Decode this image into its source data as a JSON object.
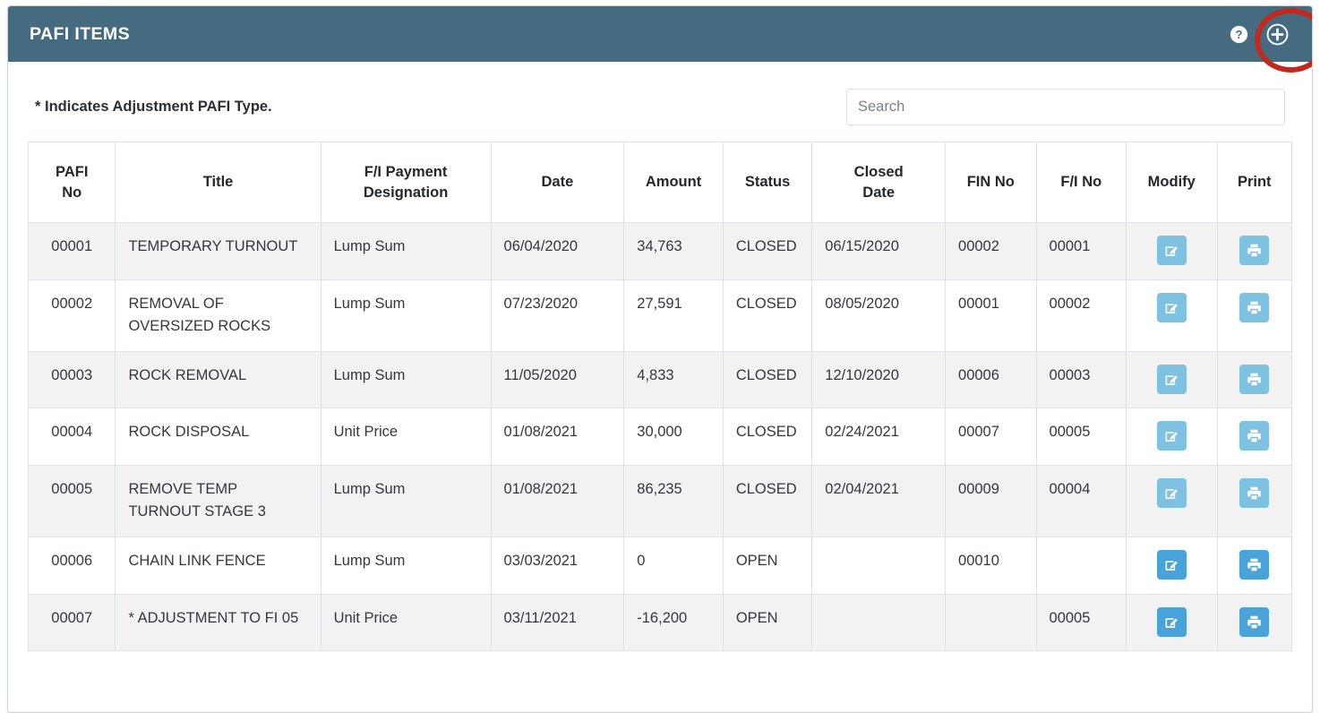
{
  "header": {
    "title": "PAFI ITEMS",
    "help_icon": "help-circle-icon",
    "add_icon": "plus-circle-icon",
    "annotation_color": "#c0291c",
    "background_color": "#456b80"
  },
  "toolbar": {
    "note": "* Indicates Adjustment PAFI Type.",
    "search_placeholder": "Search",
    "search_value": ""
  },
  "table": {
    "columns": [
      "PAFI\nNo",
      "Title",
      "F/I Payment\nDesignation",
      "Date",
      "Amount",
      "Status",
      "Closed\nDate",
      "FIN No",
      "F/I No",
      "Modify",
      "Print"
    ],
    "column_lines": [
      [
        "PAFI",
        "No"
      ],
      [
        "Title"
      ],
      [
        "F/I Payment",
        "Designation"
      ],
      [
        "Date"
      ],
      [
        "Amount"
      ],
      [
        "Status"
      ],
      [
        "Closed",
        "Date"
      ],
      [
        "FIN No"
      ],
      [
        "F/I No"
      ],
      [
        "Modify"
      ],
      [
        "Print"
      ]
    ],
    "rows": [
      {
        "pafi_no": "00001",
        "title": "TEMPORARY TURNOUT",
        "fi_payment_designation": "Lump Sum",
        "date": "06/04/2020",
        "amount": "34,763",
        "status": "CLOSED",
        "closed_date": "06/15/2020",
        "fin_no": "00002",
        "fi_no": "00001",
        "modify_icon": "edit-square-icon",
        "print_icon": "printer-icon",
        "buttons_enabled": false
      },
      {
        "pafi_no": "00002",
        "title": "REMOVAL OF OVERSIZED ROCKS",
        "fi_payment_designation": "Lump Sum",
        "date": "07/23/2020",
        "amount": "27,591",
        "status": "CLOSED",
        "closed_date": "08/05/2020",
        "fin_no": "00001",
        "fi_no": "00002",
        "modify_icon": "edit-square-icon",
        "print_icon": "printer-icon",
        "buttons_enabled": false
      },
      {
        "pafi_no": "00003",
        "title": "ROCK REMOVAL",
        "fi_payment_designation": "Lump Sum",
        "date": "11/05/2020",
        "amount": "4,833",
        "status": "CLOSED",
        "closed_date": "12/10/2020",
        "fin_no": "00006",
        "fi_no": "00003",
        "modify_icon": "edit-square-icon",
        "print_icon": "printer-icon",
        "buttons_enabled": false
      },
      {
        "pafi_no": "00004",
        "title": "ROCK DISPOSAL",
        "fi_payment_designation": "Unit Price",
        "date": "01/08/2021",
        "amount": "30,000",
        "status": "CLOSED",
        "closed_date": "02/24/2021",
        "fin_no": "00007",
        "fi_no": "00005",
        "modify_icon": "edit-square-icon",
        "print_icon": "printer-icon",
        "buttons_enabled": false
      },
      {
        "pafi_no": "00005",
        "title": "REMOVE TEMP TURNOUT STAGE 3",
        "fi_payment_designation": "Lump Sum",
        "date": "01/08/2021",
        "amount": "86,235",
        "status": "CLOSED",
        "closed_date": "02/04/2021",
        "fin_no": "00009",
        "fi_no": "00004",
        "modify_icon": "edit-square-icon",
        "print_icon": "printer-icon",
        "buttons_enabled": false
      },
      {
        "pafi_no": "00006",
        "title": "CHAIN LINK FENCE",
        "fi_payment_designation": "Lump Sum",
        "date": "03/03/2021",
        "amount": "0",
        "status": "OPEN",
        "closed_date": "",
        "fin_no": "00010",
        "fi_no": "",
        "modify_icon": "edit-square-icon",
        "print_icon": "printer-icon",
        "buttons_enabled": true
      },
      {
        "pafi_no": "00007",
        "title": "* ADJUSTMENT TO FI 05",
        "fi_payment_designation": "Unit Price",
        "date": "03/11/2021",
        "amount": "-16,200",
        "status": "OPEN",
        "closed_date": "",
        "fin_no": "",
        "fi_no": "00005",
        "modify_icon": "edit-square-icon",
        "print_icon": "printer-icon",
        "buttons_enabled": true
      }
    ]
  },
  "colors": {
    "header_bg": "#456b80",
    "stripe": "#f2f2f2",
    "border": "#dde1e6",
    "button_enabled": "#4aa3d8",
    "button_disabled": "#7fc1e0",
    "annotation": "#c0291c"
  }
}
